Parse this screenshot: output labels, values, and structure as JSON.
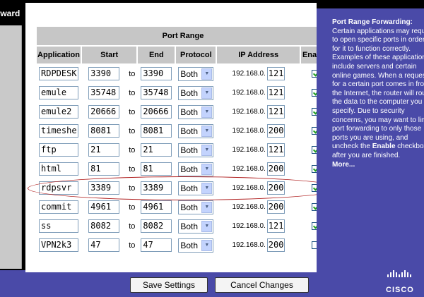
{
  "nav": {
    "title": "Forward"
  },
  "table": {
    "section_header": "Port Range",
    "headers": {
      "application": "Application",
      "start": "Start",
      "end": "End",
      "protocol": "Protocol",
      "ip": "IP Address",
      "enable": "Enable"
    },
    "to_label": "to",
    "ip_prefix": "192.168.0.",
    "rows": [
      {
        "app": "RDPDESK",
        "start": "3390",
        "end": "3390",
        "protocol": "Both",
        "ip": "121",
        "enabled": true
      },
      {
        "app": "emule",
        "start": "35748",
        "end": "35748",
        "protocol": "Both",
        "ip": "121",
        "enabled": true
      },
      {
        "app": "emule2",
        "start": "20666",
        "end": "20666",
        "protocol": "Both",
        "ip": "121",
        "enabled": true
      },
      {
        "app": "timeshe",
        "start": "8081",
        "end": "8081",
        "protocol": "Both",
        "ip": "200",
        "enabled": true
      },
      {
        "app": "ftp",
        "start": "21",
        "end": "21",
        "protocol": "Both",
        "ip": "121",
        "enabled": true
      },
      {
        "app": "html",
        "start": "81",
        "end": "81",
        "protocol": "Both",
        "ip": "200",
        "enabled": true
      },
      {
        "app": "rdpsvr",
        "start": "3389",
        "end": "3389",
        "protocol": "Both",
        "ip": "200",
        "enabled": true
      },
      {
        "app": "commit",
        "start": "4961",
        "end": "4961",
        "protocol": "Both",
        "ip": "200",
        "enabled": true
      },
      {
        "app": "ss",
        "start": "8082",
        "end": "8082",
        "protocol": "Both",
        "ip": "121",
        "enabled": true
      },
      {
        "app": "VPN2k3",
        "start": "47",
        "end": "47",
        "protocol": "Both",
        "ip": "200",
        "enabled": false
      }
    ]
  },
  "buttons": {
    "save": "Save Settings",
    "cancel": "Cancel Changes"
  },
  "help": {
    "title": "Port Range Forwarding:",
    "lines": [
      "Certain applications may require you",
      "to open specific ports in order",
      "for it to function correctly.",
      "Examples of these applications",
      "include servers and certain",
      "online games. When a request",
      "for a certain port comes in from",
      "the Internet, the router will route",
      "the data to the computer you",
      "specify. Due to security",
      "concerns, you may want to limit",
      "port forwarding to only those",
      "ports you are using, and"
    ],
    "line_uncheck_pre": "uncheck the ",
    "line_uncheck_bold": "Enable",
    "line_uncheck_post": " checkbox",
    "line_last": "after you are finished.",
    "more": "More..."
  },
  "brand": {
    "logo_text": "CISCO"
  },
  "colors": {
    "accent": "#4a4aa8",
    "header_grey": "#c6c6c6",
    "annotation": "#b02020"
  },
  "icons": {
    "checkbox": "checkbox-icon",
    "dropdown": "chevron-down-icon",
    "logo": "cisco-logo-icon"
  }
}
